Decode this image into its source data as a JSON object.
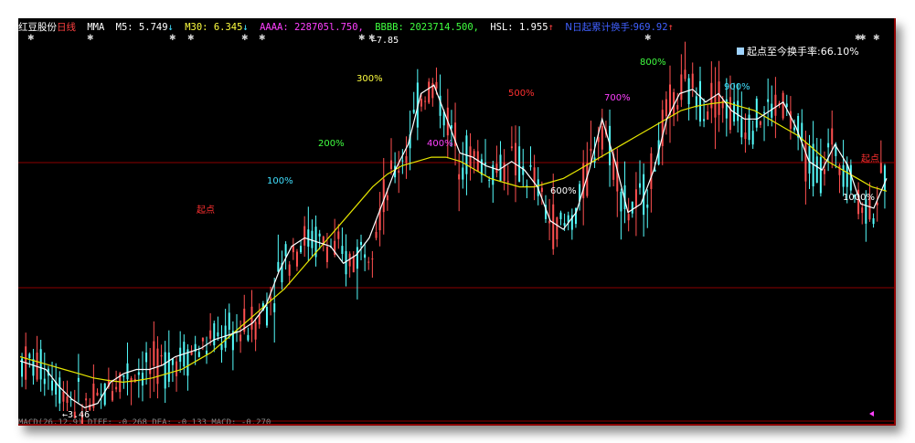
{
  "topbar": {
    "stock_name": "红豆股份",
    "period": "日线",
    "indicator": "MMA",
    "m5_label": "M5:",
    "m5_value": "5.749",
    "m5_arrow": "↓",
    "m30_label": "M30:",
    "m30_value": "6.345",
    "m30_arrow": "↓",
    "aaaa_label": "AAAA:",
    "aaaa_value": "228705l.750,",
    "bbbb_label": "BBBB:",
    "bbbb_value": "2023714.500,",
    "hsl_label": "HSL:",
    "hsl_value": "1.955",
    "hsl_arrow": "↑",
    "cum_label": "N日起累计换手:",
    "cum_value": "969.92",
    "cum_arrow": "↑"
  },
  "legend": {
    "text": "起点至今换手率:66.10%"
  },
  "bottombar": {
    "text": "MACD(26,12,9) DIFF: -0.268 DEA: -0.133 MACD: -0.270"
  },
  "colors": {
    "background": "#000000",
    "candle_up": "#ff5050",
    "candle_down": "#54fcfc",
    "ma5": "#ffffff",
    "ma30": "#e6e600",
    "grid": "#8b0000",
    "frame_shadow": "#555555"
  },
  "chart_data": {
    "type": "candlestick",
    "price_high_label": "7.85",
    "price_low_label": "3.46",
    "annotations": [
      {
        "text": "起点",
        "color": "#ff3030"
      },
      {
        "text": "100%",
        "color": "#40e0ff"
      },
      {
        "text": "200%",
        "color": "#40ff40"
      },
      {
        "text": "300%",
        "color": "#ffff40"
      },
      {
        "text": "400%",
        "color": "#ff40ff"
      },
      {
        "text": "500%",
        "color": "#ff3030"
      },
      {
        "text": "600%",
        "color": "#ffffff"
      },
      {
        "text": "700%",
        "color": "#ff40ff"
      },
      {
        "text": "800%",
        "color": "#40ff40"
      },
      {
        "text": "900%",
        "color": "#40e0ff"
      },
      {
        "text": "1000%",
        "color": "#ffffff"
      },
      {
        "text": "起点",
        "color": "#ff3030"
      }
    ],
    "ma5": [
      4.05,
      4.0,
      3.95,
      3.75,
      3.6,
      3.5,
      3.55,
      3.8,
      3.9,
      3.95,
      3.95,
      4.0,
      4.1,
      4.15,
      4.2,
      4.3,
      4.35,
      4.4,
      4.5,
      4.7,
      5.1,
      5.4,
      5.5,
      5.45,
      5.4,
      5.2,
      5.3,
      5.5,
      5.9,
      6.3,
      6.6,
      7.2,
      7.3,
      6.9,
      6.5,
      6.45,
      6.35,
      6.3,
      6.4,
      6.3,
      6.1,
      5.7,
      5.6,
      5.8,
      6.3,
      6.9,
      6.4,
      5.8,
      5.9,
      6.3,
      6.9,
      7.2,
      7.25,
      7.1,
      7.2,
      7.0,
      6.9,
      6.9,
      7.0,
      7.1,
      6.8,
      6.4,
      6.3,
      6.6,
      6.35,
      5.9,
      5.85,
      6.2
    ],
    "ma30": [
      4.1,
      4.05,
      4.0,
      3.95,
      3.9,
      3.85,
      3.82,
      3.8,
      3.82,
      3.85,
      3.9,
      3.95,
      4.05,
      4.15,
      4.3,
      4.45,
      4.6,
      4.75,
      4.9,
      5.1,
      5.3,
      5.5,
      5.7,
      5.9,
      6.1,
      6.25,
      6.35,
      6.4,
      6.45,
      6.45,
      6.4,
      6.3,
      6.2,
      6.15,
      6.1,
      6.1,
      6.15,
      6.2,
      6.3,
      6.4,
      6.5,
      6.6,
      6.7,
      6.8,
      6.9,
      7.0,
      7.05,
      7.08,
      7.1,
      7.05,
      7.0,
      6.9,
      6.8,
      6.7,
      6.55,
      6.4,
      6.3,
      6.2,
      6.1,
      6.05
    ]
  }
}
